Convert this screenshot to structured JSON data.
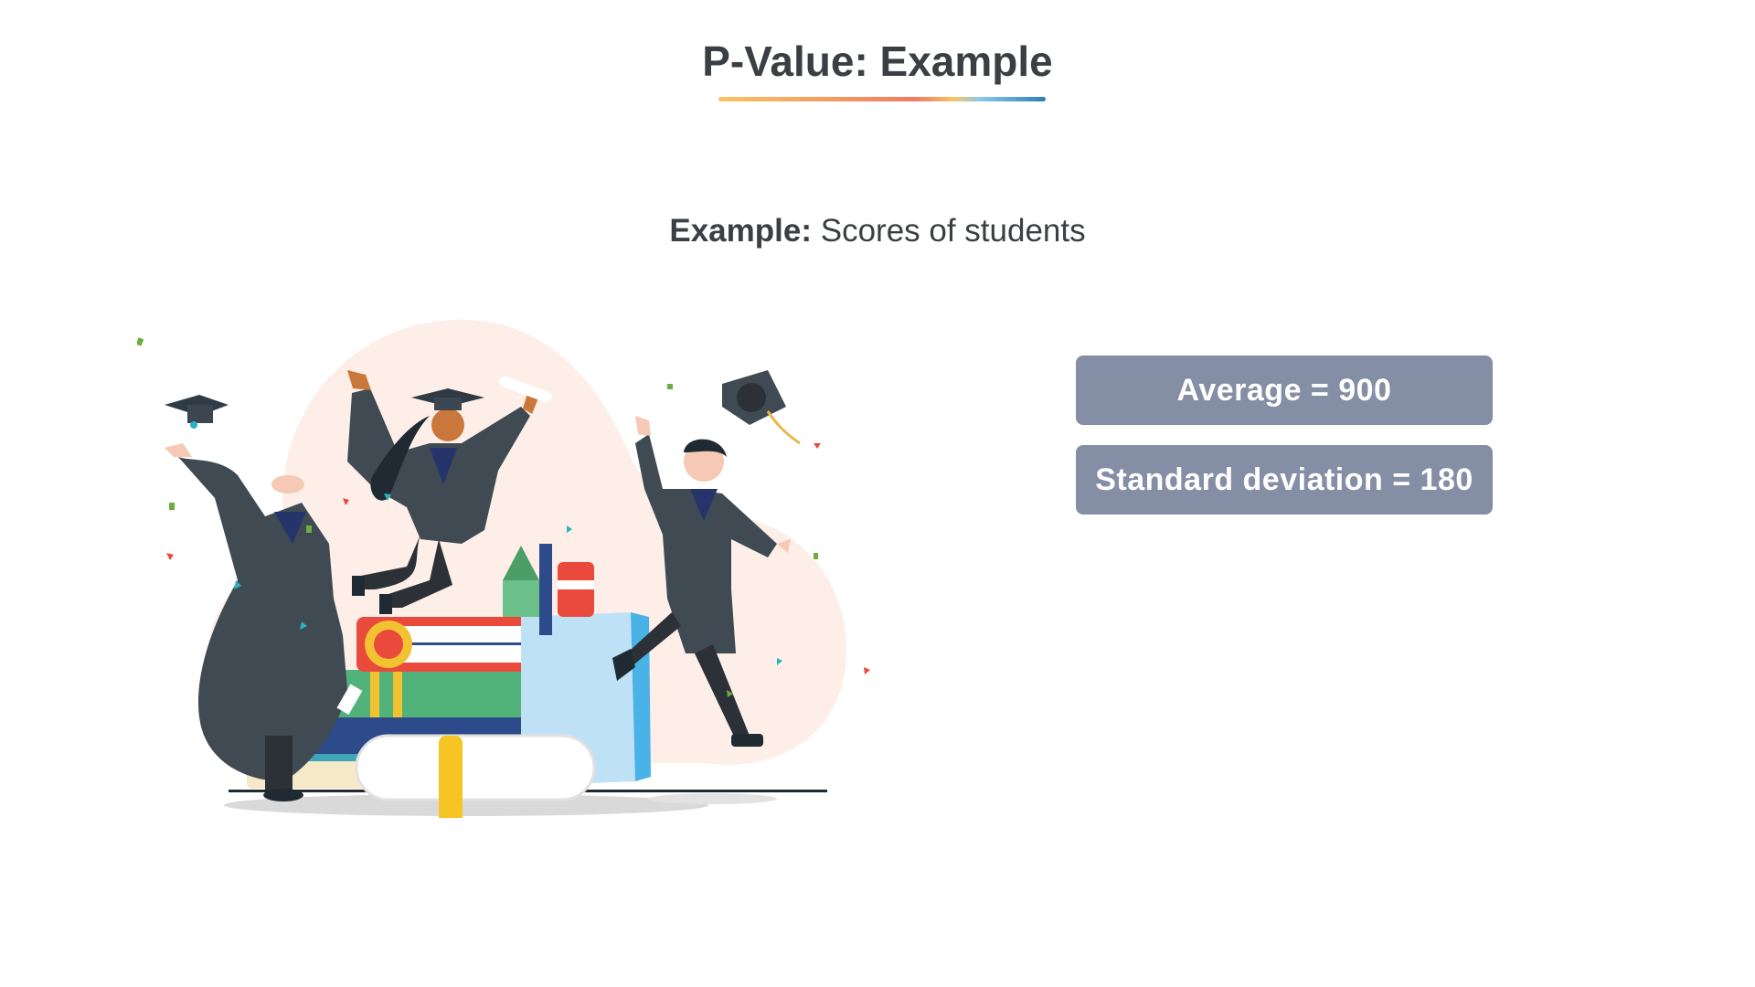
{
  "slide": {
    "title": "P-Value: Example",
    "subtitle_label": "Example:",
    "subtitle_text": " Scores of students"
  },
  "stats": {
    "average": "Average = 900",
    "standard_deviation": "Standard deviation = 180"
  },
  "colors": {
    "title_text": "#3b3f44",
    "stat_box": "#848fa5",
    "underline_gradient": [
      "#f6c567",
      "#f4a15e",
      "#ee7b63",
      "#f6c567",
      "#8cc8e8",
      "#2c7fb3"
    ],
    "illustration_blob": "#fdeee8",
    "gown": "#3f4a53"
  },
  "illustration": {
    "icon": "graduation-celebration-illustration"
  }
}
